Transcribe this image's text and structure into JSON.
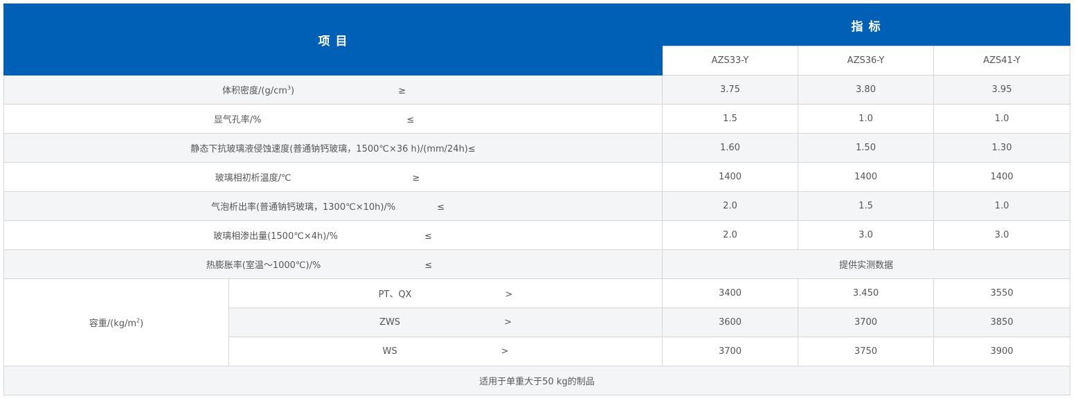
{
  "header": {
    "col_item": "项 目",
    "col_index": "指 标",
    "grades": [
      "AZS33-Y",
      "AZS36-Y",
      "AZS41-Y"
    ]
  },
  "rows": [
    {
      "label_pre": "体积密度/(g/cm",
      "label_sup": "3",
      "label_post": ")",
      "sym": "≥",
      "values": [
        "3.75",
        "3.80",
        "3.95"
      ]
    },
    {
      "label": "显气孔率/%",
      "sym": "≤",
      "values": [
        "1.5",
        "1.0",
        "1.0"
      ]
    },
    {
      "label": "静态下抗玻璃液侵蚀速度(普通钠钙玻璃，1500℃×36 h)/(mm/24h)≤",
      "values": [
        "1.60",
        "1.50",
        "1.30"
      ]
    },
    {
      "label": "玻璃相初析温度/℃",
      "sym": "≥",
      "values": [
        "1400",
        "1400",
        "1400"
      ]
    },
    {
      "label": "气泡析出率(普通钠钙玻璃，1300℃×10h)/%",
      "sym": "≤",
      "values": [
        "2.0",
        "1.5",
        "1.0"
      ]
    },
    {
      "label": "玻璃相渗出量(1500℃×4h)/%",
      "sym": "≤",
      "values": [
        "2.0",
        "3.0",
        "3.0"
      ]
    },
    {
      "label": "热膨胀率(室温～1000℃)/%",
      "sym": "≤",
      "merged_value": "提供实测数据"
    }
  ],
  "bulk_weight": {
    "label_pre": "容重/(kg/m",
    "label_sup": "2",
    "label_post": ")",
    "subrows": [
      {
        "name": "PT、QX",
        "sym": ">",
        "values": [
          "3400",
          "3.450",
          "3550"
        ]
      },
      {
        "name": "ZWS",
        "sym": ">",
        "values": [
          "3600",
          "3700",
          "3850"
        ]
      },
      {
        "name": "WS",
        "sym": ">",
        "values": [
          "3700",
          "3750",
          "3900"
        ]
      }
    ]
  },
  "footer_note": "适用于单重大于50 kg的制品"
}
